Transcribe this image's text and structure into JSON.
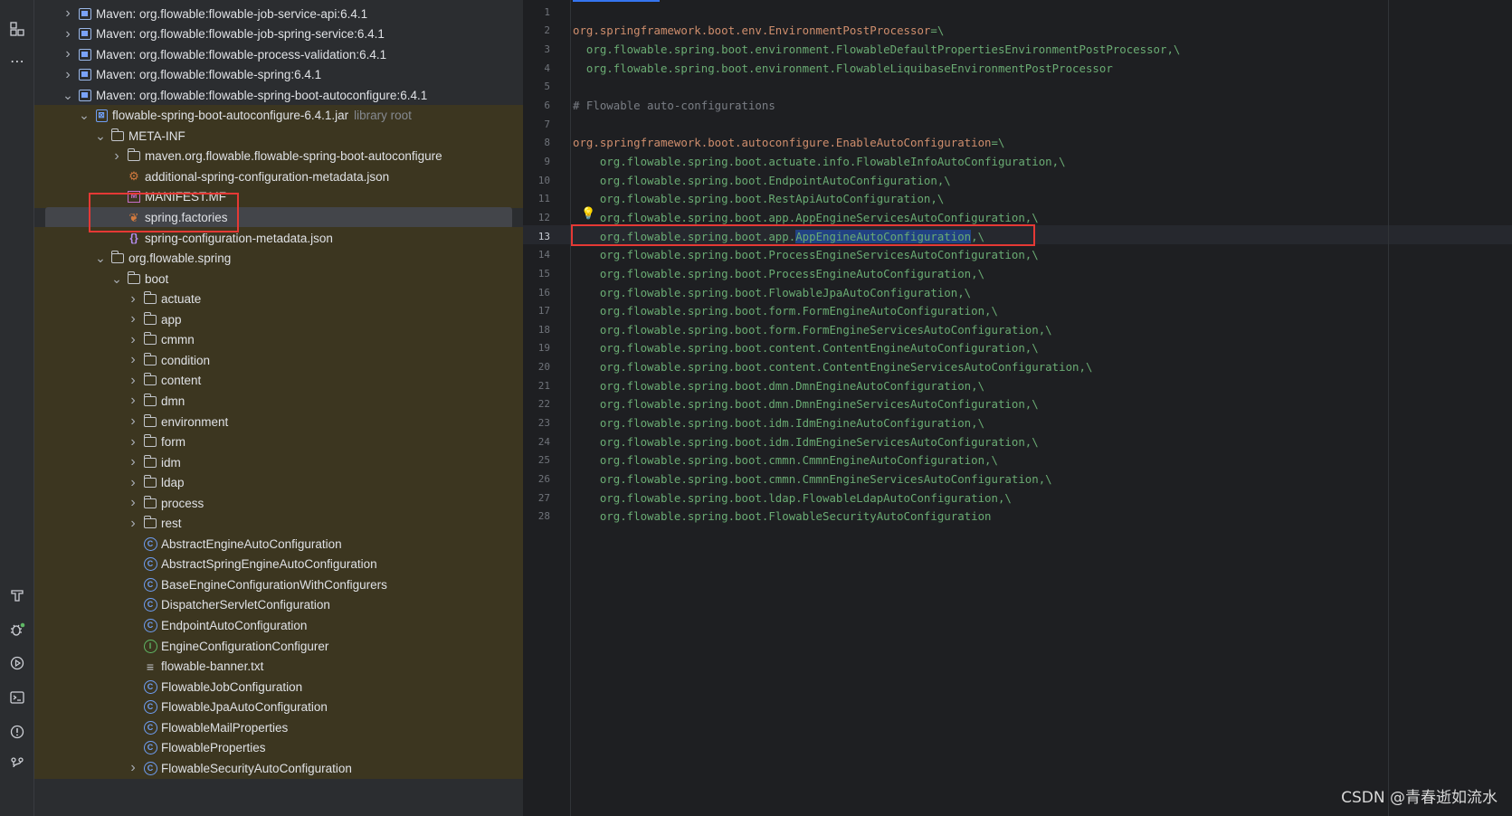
{
  "activity_bar": {
    "top_icons": [
      "structure-icon",
      "more-icon"
    ],
    "bottom_icons": [
      "build-icon",
      "debug-icon",
      "run-icon",
      "terminal-icon",
      "problems-icon",
      "vcs-icon"
    ]
  },
  "project_tree": {
    "rows": [
      {
        "indent": 0,
        "arrow": "collapsed",
        "icon": "maven-icon",
        "label": "Maven: org.flowable:flowable-job-service-api:6.4.1",
        "hint": "",
        "style": ""
      },
      {
        "indent": 0,
        "arrow": "collapsed",
        "icon": "maven-icon",
        "label": "Maven: org.flowable:flowable-job-spring-service:6.4.1",
        "hint": "",
        "style": ""
      },
      {
        "indent": 0,
        "arrow": "collapsed",
        "icon": "maven-icon",
        "label": "Maven: org.flowable:flowable-process-validation:6.4.1",
        "hint": "",
        "style": ""
      },
      {
        "indent": 0,
        "arrow": "collapsed",
        "icon": "maven-icon",
        "label": "Maven: org.flowable:flowable-spring:6.4.1",
        "hint": "",
        "style": ""
      },
      {
        "indent": 0,
        "arrow": "expanded",
        "icon": "maven-icon",
        "label": "Maven: org.flowable:flowable-spring-boot-autoconfigure:6.4.1",
        "hint": "",
        "style": ""
      },
      {
        "indent": 1,
        "arrow": "expanded",
        "icon": "jar-icon",
        "label": "flowable-spring-boot-autoconfigure-6.4.1.jar",
        "hint": "library root",
        "style": "lib"
      },
      {
        "indent": 2,
        "arrow": "expanded",
        "icon": "folder-icon",
        "label": "META-INF",
        "hint": "",
        "style": "lib"
      },
      {
        "indent": 3,
        "arrow": "collapsed",
        "icon": "folder-icon",
        "label": "maven.org.flowable.flowable-spring-boot-autoconfigure",
        "hint": "",
        "style": "lib"
      },
      {
        "indent": 3,
        "arrow": "none",
        "icon": "json-config-icon",
        "label": "additional-spring-configuration-metadata.json",
        "hint": "",
        "style": "lib"
      },
      {
        "indent": 3,
        "arrow": "none",
        "icon": "manifest-icon",
        "label": "MANIFEST.MF",
        "hint": "",
        "style": "lib"
      },
      {
        "indent": 3,
        "arrow": "none",
        "icon": "spring-factories-icon",
        "label": "spring.factories",
        "hint": "",
        "style": "selected"
      },
      {
        "indent": 3,
        "arrow": "none",
        "icon": "json-icon",
        "label": "spring-configuration-metadata.json",
        "hint": "",
        "style": "lib"
      },
      {
        "indent": 2,
        "arrow": "expanded",
        "icon": "folder-icon",
        "label": "org.flowable.spring",
        "hint": "",
        "style": "lib"
      },
      {
        "indent": 3,
        "arrow": "expanded",
        "icon": "folder-icon",
        "label": "boot",
        "hint": "",
        "style": "lib"
      },
      {
        "indent": 4,
        "arrow": "collapsed",
        "icon": "folder-icon",
        "label": "actuate",
        "hint": "",
        "style": "lib"
      },
      {
        "indent": 4,
        "arrow": "collapsed",
        "icon": "folder-icon",
        "label": "app",
        "hint": "",
        "style": "lib"
      },
      {
        "indent": 4,
        "arrow": "collapsed",
        "icon": "folder-icon",
        "label": "cmmn",
        "hint": "",
        "style": "lib"
      },
      {
        "indent": 4,
        "arrow": "collapsed",
        "icon": "folder-icon",
        "label": "condition",
        "hint": "",
        "style": "lib"
      },
      {
        "indent": 4,
        "arrow": "collapsed",
        "icon": "folder-icon",
        "label": "content",
        "hint": "",
        "style": "lib"
      },
      {
        "indent": 4,
        "arrow": "collapsed",
        "icon": "folder-icon",
        "label": "dmn",
        "hint": "",
        "style": "lib"
      },
      {
        "indent": 4,
        "arrow": "collapsed",
        "icon": "folder-icon",
        "label": "environment",
        "hint": "",
        "style": "lib"
      },
      {
        "indent": 4,
        "arrow": "collapsed",
        "icon": "folder-icon",
        "label": "form",
        "hint": "",
        "style": "lib"
      },
      {
        "indent": 4,
        "arrow": "collapsed",
        "icon": "folder-icon",
        "label": "idm",
        "hint": "",
        "style": "lib"
      },
      {
        "indent": 4,
        "arrow": "collapsed",
        "icon": "folder-icon",
        "label": "ldap",
        "hint": "",
        "style": "lib"
      },
      {
        "indent": 4,
        "arrow": "collapsed",
        "icon": "folder-icon",
        "label": "process",
        "hint": "",
        "style": "lib"
      },
      {
        "indent": 4,
        "arrow": "collapsed",
        "icon": "folder-icon",
        "label": "rest",
        "hint": "",
        "style": "lib"
      },
      {
        "indent": 4,
        "arrow": "none",
        "icon": "abstract-class-icon",
        "label": "AbstractEngineAutoConfiguration",
        "hint": "",
        "style": "lib"
      },
      {
        "indent": 4,
        "arrow": "none",
        "icon": "abstract-class-icon",
        "label": "AbstractSpringEngineAutoConfiguration",
        "hint": "",
        "style": "lib"
      },
      {
        "indent": 4,
        "arrow": "none",
        "icon": "abstract-class-icon",
        "label": "BaseEngineConfigurationWithConfigurers",
        "hint": "",
        "style": "lib"
      },
      {
        "indent": 4,
        "arrow": "none",
        "icon": "class-icon",
        "label": "DispatcherServletConfiguration",
        "hint": "",
        "style": "lib"
      },
      {
        "indent": 4,
        "arrow": "none",
        "icon": "class-icon",
        "label": "EndpointAutoConfiguration",
        "hint": "",
        "style": "lib"
      },
      {
        "indent": 4,
        "arrow": "none",
        "icon": "interface-icon",
        "label": "EngineConfigurationConfigurer",
        "hint": "",
        "style": "lib"
      },
      {
        "indent": 4,
        "arrow": "none",
        "icon": "text-file-icon",
        "label": "flowable-banner.txt",
        "hint": "",
        "style": "lib"
      },
      {
        "indent": 4,
        "arrow": "none",
        "icon": "class-icon",
        "label": "FlowableJobConfiguration",
        "hint": "",
        "style": "lib"
      },
      {
        "indent": 4,
        "arrow": "none",
        "icon": "class-icon",
        "label": "FlowableJpaAutoConfiguration",
        "hint": "",
        "style": "lib"
      },
      {
        "indent": 4,
        "arrow": "none",
        "icon": "class-icon",
        "label": "FlowableMailProperties",
        "hint": "",
        "style": "lib"
      },
      {
        "indent": 4,
        "arrow": "none",
        "icon": "class-icon",
        "label": "FlowableProperties",
        "hint": "",
        "style": "lib"
      },
      {
        "indent": 4,
        "arrow": "collapsed",
        "icon": "class-icon",
        "label": "FlowableSecurityAutoConfiguration",
        "hint": "",
        "style": "lib"
      }
    ]
  },
  "editor": {
    "current_line": 13,
    "lines": [
      {
        "n": "1",
        "parts": []
      },
      {
        "n": "2",
        "parts": [
          {
            "t": "org.springframework.boot.env.EnvironmentPostProcessor",
            "c": "k"
          },
          {
            "t": "=\\",
            "c": "v"
          }
        ]
      },
      {
        "n": "3",
        "parts": [
          {
            "t": "  org.flowable.spring.boot.environment.FlowableDefaultPropertiesEnvironmentPostProcessor,\\",
            "c": "v"
          }
        ]
      },
      {
        "n": "4",
        "parts": [
          {
            "t": "  org.flowable.spring.boot.environment.FlowableLiquibaseEnvironmentPostProcessor",
            "c": "v"
          }
        ]
      },
      {
        "n": "5",
        "parts": []
      },
      {
        "n": "6",
        "parts": [
          {
            "t": "# Flowable auto-configurations",
            "c": "c"
          }
        ]
      },
      {
        "n": "7",
        "parts": []
      },
      {
        "n": "8",
        "parts": [
          {
            "t": "org.springframework.boot.autoconfigure.EnableAutoConfiguration",
            "c": "k"
          },
          {
            "t": "=\\",
            "c": "v"
          }
        ]
      },
      {
        "n": "9",
        "parts": [
          {
            "t": "    org.flowable.spring.boot.actuate.info.FlowableInfoAutoConfiguration,\\",
            "c": "v"
          }
        ]
      },
      {
        "n": "10",
        "parts": [
          {
            "t": "    org.flowable.spring.boot.EndpointAutoConfiguration,\\",
            "c": "v"
          }
        ]
      },
      {
        "n": "11",
        "parts": [
          {
            "t": "    org.flowable.spring.boot.RestApiAutoConfiguration,\\",
            "c": "v"
          }
        ]
      },
      {
        "n": "12",
        "parts": [
          {
            "t": "    org.flowable.spring.boot.app.AppEngineServicesAutoConfiguration,\\",
            "c": "v"
          }
        ]
      },
      {
        "n": "13",
        "parts": [
          {
            "t": "    org.flowable.spring.boot.app.",
            "c": "v"
          },
          {
            "t": "AppEngineAutoConfiguration",
            "c": "sel"
          },
          {
            "t": ",\\",
            "c": "v"
          }
        ]
      },
      {
        "n": "14",
        "parts": [
          {
            "t": "    org.flowable.spring.boot.ProcessEngineServicesAutoConfiguration,\\",
            "c": "v"
          }
        ]
      },
      {
        "n": "15",
        "parts": [
          {
            "t": "    org.flowable.spring.boot.ProcessEngineAutoConfiguration,\\",
            "c": "v"
          }
        ]
      },
      {
        "n": "16",
        "parts": [
          {
            "t": "    org.flowable.spring.boot.FlowableJpaAutoConfiguration,\\",
            "c": "v"
          }
        ]
      },
      {
        "n": "17",
        "parts": [
          {
            "t": "    org.flowable.spring.boot.form.FormEngineAutoConfiguration,\\",
            "c": "v"
          }
        ]
      },
      {
        "n": "18",
        "parts": [
          {
            "t": "    org.flowable.spring.boot.form.FormEngineServicesAutoConfiguration,\\",
            "c": "v"
          }
        ]
      },
      {
        "n": "19",
        "parts": [
          {
            "t": "    org.flowable.spring.boot.content.ContentEngineAutoConfiguration,\\",
            "c": "v"
          }
        ]
      },
      {
        "n": "20",
        "parts": [
          {
            "t": "    org.flowable.spring.boot.content.ContentEngineServicesAutoConfiguration,\\",
            "c": "v"
          }
        ]
      },
      {
        "n": "21",
        "parts": [
          {
            "t": "    org.flowable.spring.boot.dmn.DmnEngineAutoConfiguration,\\",
            "c": "v"
          }
        ]
      },
      {
        "n": "22",
        "parts": [
          {
            "t": "    org.flowable.spring.boot.dmn.DmnEngineServicesAutoConfiguration,\\",
            "c": "v"
          }
        ]
      },
      {
        "n": "23",
        "parts": [
          {
            "t": "    org.flowable.spring.boot.idm.IdmEngineAutoConfiguration,\\",
            "c": "v"
          }
        ]
      },
      {
        "n": "24",
        "parts": [
          {
            "t": "    org.flowable.spring.boot.idm.IdmEngineServicesAutoConfiguration,\\",
            "c": "v"
          }
        ]
      },
      {
        "n": "25",
        "parts": [
          {
            "t": "    org.flowable.spring.boot.cmmn.CmmnEngineAutoConfiguration,\\",
            "c": "v"
          }
        ]
      },
      {
        "n": "26",
        "parts": [
          {
            "t": "    org.flowable.spring.boot.cmmn.CmmnEngineServicesAutoConfiguration,\\",
            "c": "v"
          }
        ]
      },
      {
        "n": "27",
        "parts": [
          {
            "t": "    org.flowable.spring.boot.ldap.FlowableLdapAutoConfiguration,\\",
            "c": "v"
          }
        ]
      },
      {
        "n": "28",
        "parts": [
          {
            "t": "    org.flowable.spring.boot.FlowableSecurityAutoConfiguration",
            "c": "v"
          }
        ]
      }
    ]
  },
  "watermark": "CSDN @青春逝如流水"
}
